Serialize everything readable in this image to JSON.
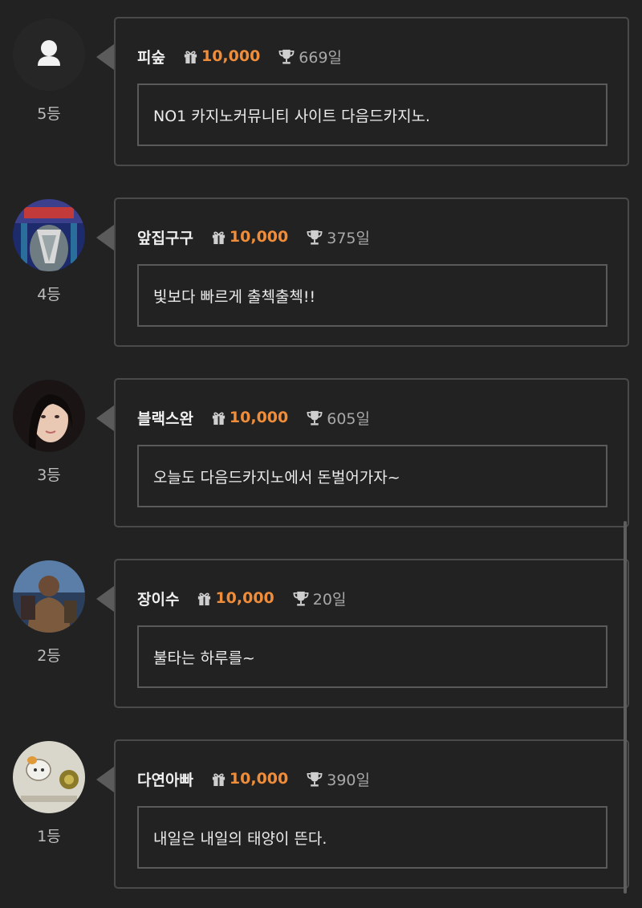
{
  "entries": [
    {
      "nickname": "피숲",
      "points": "10,000",
      "days": "669일",
      "message": "NO1 카지노커뮤니티 사이트 다음드카지노.",
      "rank": "5등"
    },
    {
      "nickname": "앞집구구",
      "points": "10,000",
      "days": "375일",
      "message": "빛보다 빠르게 출첵출첵!!",
      "rank": "4등"
    },
    {
      "nickname": "블랙스완",
      "points": "10,000",
      "days": "605일",
      "message": "오늘도 다음드카지노에서 돈벌어가자~",
      "rank": "3등"
    },
    {
      "nickname": "장이수",
      "points": "10,000",
      "days": "20일",
      "message": "불타는 하루를~",
      "rank": "2등"
    },
    {
      "nickname": "다연아빠",
      "points": "10,000",
      "days": "390일",
      "message": "내일은 내일의 태양이 뜬다.",
      "rank": "1등"
    }
  ],
  "icons": {
    "gift": "gift-icon",
    "trophy": "trophy-icon",
    "default_avatar": "user-icon"
  },
  "colors": {
    "background": "#222222",
    "points": "#f08d3a",
    "border": "#4a4a4a"
  }
}
